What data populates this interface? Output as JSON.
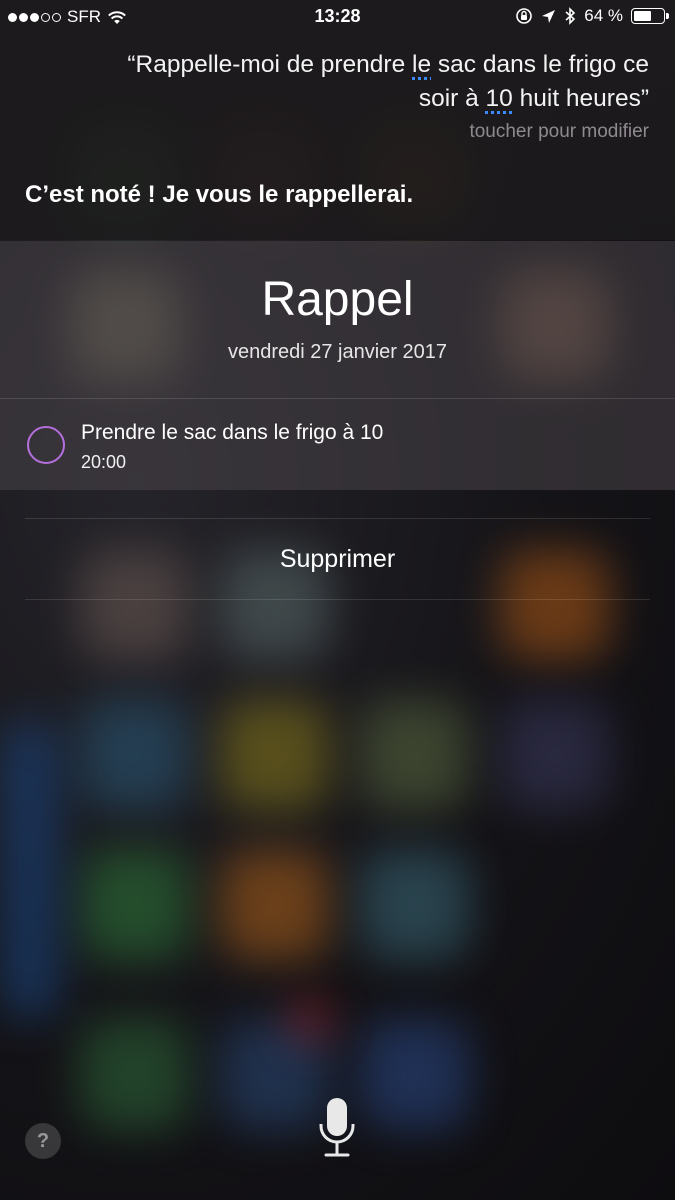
{
  "status_bar": {
    "carrier": "SFR",
    "signal_bars_filled": 3,
    "signal_bars_total": 5,
    "time": "13:28",
    "battery_text": "64 %",
    "battery_level": 0.64
  },
  "siri": {
    "quote_part1": "“Rappelle-moi de prendre ",
    "quote_ambiguous1": "le",
    "quote_part2": " sac dans le frigo ce soir à ",
    "quote_ambiguous2": "10",
    "quote_part3": " huit heures”",
    "tap_to_edit": "toucher pour modifier",
    "response": "C’est noté ! Je vous le rappellerai."
  },
  "reminder_card": {
    "title": "Rappel",
    "date": "vendredi 27 janvier 2017",
    "item": {
      "title": "Prendre le sac dans le frigo à 10",
      "time": "20:00"
    }
  },
  "actions": {
    "delete_label": "Supprimer"
  },
  "bottom": {
    "help_label": "?"
  },
  "colors": {
    "checkbox_ring": "#b56fdc",
    "ambiguity_underline": "#3a8bff"
  }
}
